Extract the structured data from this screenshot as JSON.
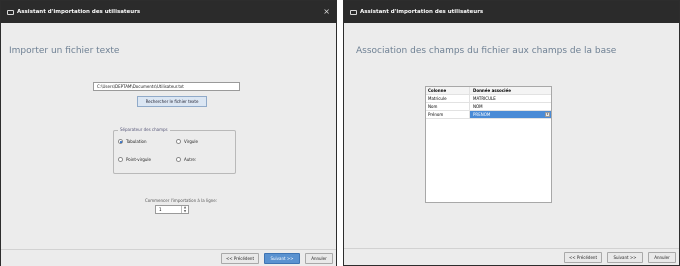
{
  "left_window": {
    "title": "Assistant d'importation des utilisateurs",
    "close_glyph": "×",
    "heading": "Importer un fichier texte",
    "file_path": "C:\\Users\\DEPTAM\\Documents\\Utilisateur.txt",
    "browse_label": "Rechercher le fichier texte",
    "separator_group_label": "Séparateur des champs",
    "options": {
      "tabulation": "Tabulation",
      "virgule": "Virgule",
      "point_virgule": "Point-virgule",
      "autre": "Autre:"
    },
    "selected_option": "Tabulation",
    "start_line_label": "Commencer l'importation à la ligne:",
    "start_line_value": "1",
    "footer": {
      "prev": "<< Précédent",
      "next": "Suivant >>",
      "cancel": "Annuler"
    }
  },
  "right_window": {
    "title": "Assistant d'importation des utilisateurs",
    "heading": "Association des champs du fichier aux champs de la base",
    "table": {
      "headers": [
        "Colonne",
        "Donnée associée"
      ],
      "rows": [
        [
          "Matricule",
          "MATRICULE"
        ],
        [
          "Nom",
          "NOM"
        ],
        [
          "Prénom",
          "PRENOM"
        ]
      ]
    },
    "footer": {
      "prev": "<< Précédent",
      "next": "Suivant >>",
      "cancel": "Annuler"
    }
  },
  "colors": {
    "titlebar": "#2b2b2b",
    "accent": "#5a92d0",
    "heading": "#6f8194",
    "selected_cell": "#4a8bd6"
  }
}
